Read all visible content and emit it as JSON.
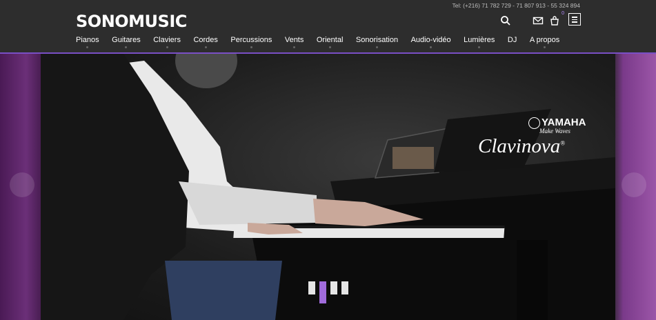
{
  "header": {
    "logo": "SONOMUSIC",
    "tel": "Tel: (+216) 71 782 729 - 71 807 913 - 55 324 894",
    "cart_count": "0"
  },
  "nav": [
    {
      "label": "Pianos"
    },
    {
      "label": "Guitares"
    },
    {
      "label": "Claviers"
    },
    {
      "label": "Cordes"
    },
    {
      "label": "Percussions"
    },
    {
      "label": "Vents"
    },
    {
      "label": "Oriental"
    },
    {
      "label": "Sonorisation"
    },
    {
      "label": "Audio-vidéo"
    },
    {
      "label": "Lumières"
    },
    {
      "label": "DJ"
    },
    {
      "label": "A propos"
    }
  ],
  "hero": {
    "brand": "YAMAHA",
    "tagline": "Make Waves",
    "product": "Clavinova",
    "product_mark": "®",
    "slides_total": 4,
    "active_slide": 2
  },
  "icons": {
    "search": "search-icon",
    "mail": "mail-icon",
    "cart": "cart-icon",
    "menu": "menu-icon"
  },
  "colors": {
    "accent": "#7a4fc6",
    "pagination_active": "#a06bdb"
  }
}
